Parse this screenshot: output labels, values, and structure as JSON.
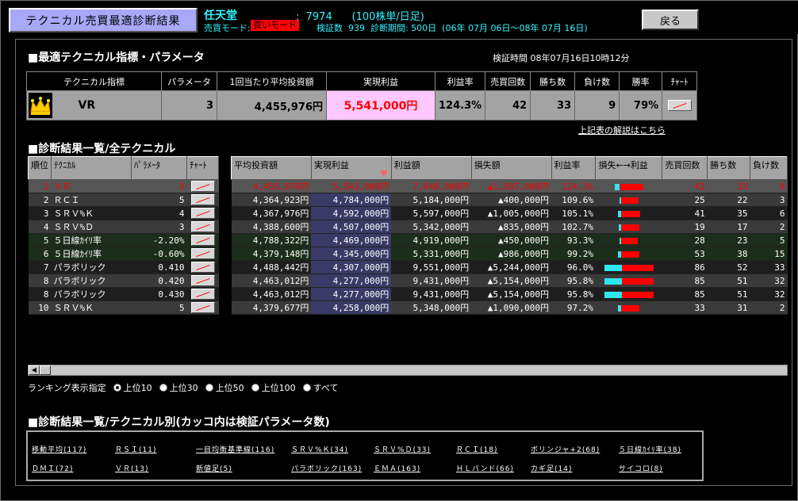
{
  "header": {
    "title": "テクニカル売買最適診断結果",
    "company": "任天堂",
    "code_line": ":  7974      (100株単/日足)",
    "mode_label": "売買モード:",
    "mode_value": "買いモード",
    "kensho_line": "検証数  939  診断期間: 500日  (06年 07月 06日〜08年 07月 16日)",
    "back": "戻る"
  },
  "best": {
    "section": "■最適テクニカル指標・パラメータ",
    "verified": "検証時間 08年07月16日10時12分",
    "headers": [
      "テクニカル指標",
      "パラメータ",
      "1回当たり平均投資額",
      "実現利益",
      "利益率",
      "売買回数",
      "勝ち数",
      "負け数",
      "勝率",
      "ﾁｬｰﾄ"
    ],
    "indicator": "VR",
    "param": "3",
    "avg": "4,455,976円",
    "profit": "5,541,000円",
    "rate": "124.3%",
    "trades": "42",
    "wins": "33",
    "losses": "9",
    "winrate": "79%",
    "explain": "上記表の解説はこちら"
  },
  "list": {
    "section": "■診断結果一覧/全テクニカル",
    "left_headers": [
      "順位",
      "ﾃｸﾆｶﾙ",
      "ﾊﾟﾗﾒｰﾀ",
      "ﾁｬｰﾄ"
    ],
    "right_headers": [
      "平均投資額",
      "実現利益",
      "利益額",
      "損失額",
      "利益率",
      "損失←→利益",
      "売買回数",
      "勝ち数",
      "負け数"
    ],
    "rows": [
      {
        "r": "1",
        "t": "ＶＲ",
        "p": "3",
        "avg": "4,455,976円",
        "real": "5,541,000円",
        "gain": "7,048,000円",
        "loss": "▲1,507,000円",
        "rate": "124.3%",
        "l": 6,
        "g": 30,
        "n": "42",
        "w": "33",
        "x": "9"
      },
      {
        "r": "2",
        "t": "ＲＣＩ",
        "p": "5",
        "avg": "4,364,923円",
        "real": "4,784,000円",
        "gain": "5,184,000円",
        "loss": "▲400,000円",
        "rate": "109.6%",
        "l": 2,
        "g": 22,
        "n": "25",
        "w": "22",
        "x": "3"
      },
      {
        "r": "3",
        "t": "ＳＲＶ%Ｋ",
        "p": "4",
        "avg": "4,367,976円",
        "real": "4,592,000円",
        "gain": "5,597,000円",
        "loss": "▲1,005,000円",
        "rate": "105.1%",
        "l": 4,
        "g": 24,
        "n": "41",
        "w": "35",
        "x": "6"
      },
      {
        "r": "4",
        "t": "ＳＲＶ%Ｄ",
        "p": "3",
        "avg": "4,388,600円",
        "real": "4,507,000円",
        "gain": "5,342,000円",
        "loss": "▲835,000円",
        "rate": "102.7%",
        "l": 3,
        "g": 23,
        "n": "19",
        "w": "17",
        "x": "2"
      },
      {
        "r": "5",
        "t": "５日線ｶｲﾘ率",
        "p": "-2.20%",
        "avg": "4,788,322円",
        "real": "4,469,000円",
        "gain": "4,919,000円",
        "loss": "▲450,000円",
        "rate": "93.3%",
        "l": 2,
        "g": 21,
        "n": "28",
        "w": "23",
        "x": "5"
      },
      {
        "r": "6",
        "t": "５日線ｶｲﾘ率",
        "p": "-0.60%",
        "avg": "4,379,148円",
        "real": "4,345,000円",
        "gain": "5,331,000円",
        "loss": "▲986,000円",
        "rate": "99.2%",
        "l": 4,
        "g": 23,
        "n": "53",
        "w": "38",
        "x": "15"
      },
      {
        "r": "7",
        "t": "パラボリック",
        "p": "0.410",
        "avg": "4,488,442円",
        "real": "4,307,000円",
        "gain": "9,551,000円",
        "loss": "▲5,244,000円",
        "rate": "96.0%",
        "l": 22,
        "g": 40,
        "n": "86",
        "w": "52",
        "x": "33"
      },
      {
        "r": "8",
        "t": "パラボリック",
        "p": "0.420",
        "avg": "4,463,012円",
        "real": "4,277,000円",
        "gain": "9,431,000円",
        "loss": "▲5,154,000円",
        "rate": "95.8%",
        "l": 22,
        "g": 40,
        "n": "85",
        "w": "51",
        "x": "32"
      },
      {
        "r": "8",
        "t": "パラボリック",
        "p": "0.430",
        "avg": "4,463,012円",
        "real": "4,277,000円",
        "gain": "9,431,000円",
        "loss": "▲5,154,000円",
        "rate": "95.8%",
        "l": 22,
        "g": 40,
        "n": "85",
        "w": "51",
        "x": "32"
      },
      {
        "r": "10",
        "t": "ＳＲＶ%Ｋ",
        "p": "5",
        "avg": "4,379,677円",
        "real": "4,258,000円",
        "gain": "5,348,000円",
        "loss": "▲1,090,000円",
        "rate": "97.2%",
        "l": 4,
        "g": 23,
        "n": "33",
        "w": "31",
        "x": "2"
      }
    ]
  },
  "ranking": {
    "label": "ランキング表示指定",
    "options": [
      "上位10",
      "上位30",
      "上位50",
      "上位100",
      "すべて"
    ]
  },
  "bytech": {
    "section": "■診断結果一覧/テクニカル別(カッコ内は検証パラメータ数)",
    "links": [
      "移動平均(117)",
      "ＲＳＩ(11)",
      "一目均衡基準線(116)",
      "ＳＲＶ%Ｋ(34)",
      "ＳＲＶ%Ｄ(33)",
      "ＲＣＩ(18)",
      "ボリンジャ+2(68)",
      "５日線ｶｲﾘ率(38)",
      "ＤＭＩ(72)",
      "ＶＲ(13)",
      "新値足(5)",
      "パラボリック(163)",
      "ＥＭＡ(163)",
      "ＨＬバンド(66)",
      "カギ足(14)",
      "サイコロ(8)"
    ]
  },
  "colors": {
    "accent": "#31f4ff",
    "loss": "#ff0000",
    "gain_bar": "#ff0000",
    "loss_bar": "#2ee6f0",
    "title_bg": "#a8a8f8"
  }
}
